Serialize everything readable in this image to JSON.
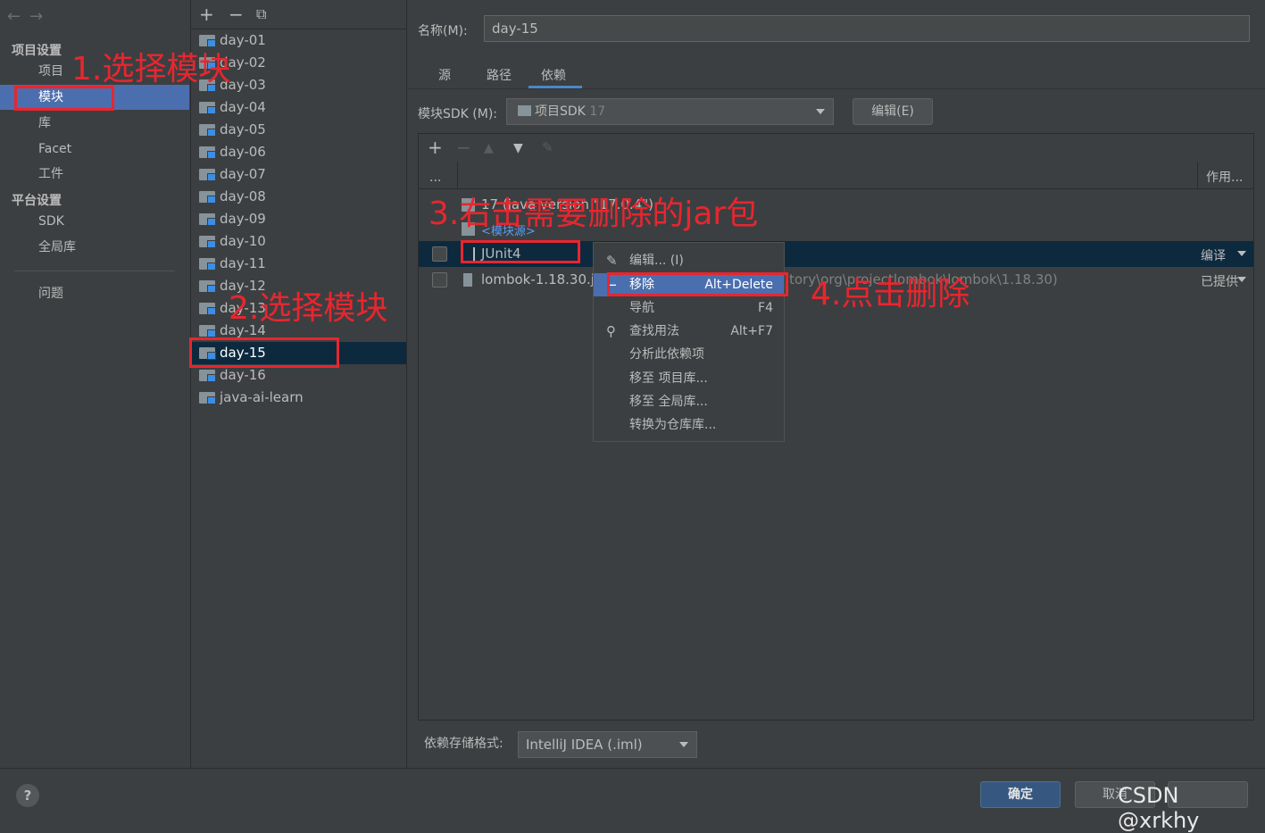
{
  "sidebar": {
    "project_settings_title": "项目设置",
    "items_top": [
      "项目",
      "模块",
      "库",
      "Facet",
      "工件"
    ],
    "platform_settings_title": "平台设置",
    "items_platform": [
      "SDK",
      "全局库"
    ],
    "problems": "问题"
  },
  "modules": [
    "day-01",
    "day-02",
    "day-03",
    "day-04",
    "day-05",
    "day-06",
    "day-07",
    "day-08",
    "day-09",
    "day-10",
    "day-11",
    "day-12",
    "day-13",
    "day-14",
    "day-15",
    "day-16",
    "java-ai-learn"
  ],
  "form": {
    "name_label": "名称(M):",
    "name_value": "day-15",
    "tabs": [
      "源",
      "路径",
      "依赖"
    ],
    "sdk_label": "模块SDK (M):",
    "sdk_name": "项目SDK",
    "sdk_version": "17",
    "edit_button": "编辑(E)"
  },
  "deps": {
    "col_dots": "...",
    "col_scope": "作用...",
    "jdk_row": "17 (java version \"17.0.4\")",
    "module_source": "<模块源>",
    "junit": "JUnit4",
    "junit_scope": "编译",
    "lombok": "lombok-1.18.30.j",
    "lombok_path": "tory\\org\\projectlombok\\lombok\\1.18.30)",
    "lombok_scope": "已提供"
  },
  "context_menu": {
    "edit": "编辑... (I)",
    "remove": "移除",
    "remove_shortcut": "Alt+Delete",
    "navigate": "导航",
    "navigate_shortcut": "F4",
    "find_usages": "查找用法",
    "find_shortcut": "Alt+F7",
    "analyze": "分析此依赖项",
    "move_project": "移至 项目库...",
    "move_global": "移至 全局库...",
    "convert_repo": "转换为仓库库..."
  },
  "storage": {
    "label": "依赖存储格式:",
    "value": "IntelliJ IDEA (.iml)"
  },
  "footer": {
    "help": "?",
    "ok": "确定",
    "cancel": "取消",
    "watermark": "CSDN @xrkhy"
  },
  "annotations": {
    "step1": "1.选择模块",
    "step2": "2.选择模块",
    "step3": "3.右击需要删除的jar包",
    "step4": "4.点击删除"
  },
  "colors": {
    "annotation": "#e8262f",
    "selection": "#4b6eaf",
    "background": "#3c3f41"
  }
}
